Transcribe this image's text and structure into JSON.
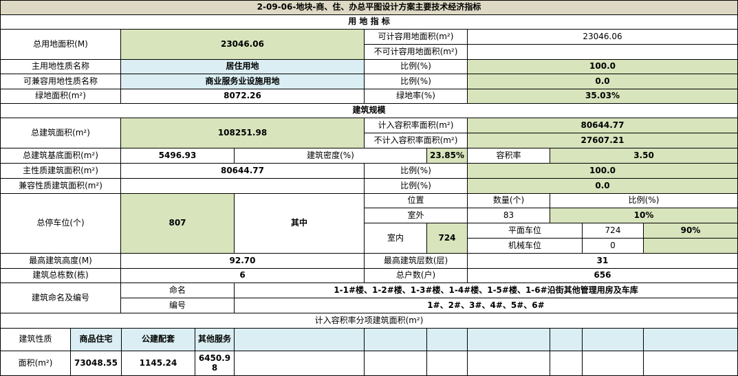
{
  "title": "2-09-06-地块-商、住、办总平图设计方案主要技术经济指标",
  "colors": {
    "green": "#d8e4bc",
    "blue": "#daeef3",
    "header": "#ddd9c4"
  },
  "land": {
    "section": "用 地 指 标",
    "total_label": "总用地面积(M)",
    "total_value": "23046.06",
    "calc_label": "可计容用地面积(m²)",
    "calc_value": "23046.06",
    "noncalc_label": "不可计容用地面积(m²)",
    "noncalc_value": "",
    "main_use_label": "主用地性质名称",
    "main_use_value": "居住用地",
    "ratio_label": "比例(%)",
    "main_ratio": "100.0",
    "compat_use_label": "可兼容用地性质名称",
    "compat_use_value": "商业服务业设施用地",
    "compat_ratio": "0.0",
    "green_area_label": "绿地面积(m²)",
    "green_area_value": "8072.26",
    "green_rate_label": "绿地率(%)",
    "green_rate_value": "35.03%"
  },
  "building": {
    "section": "建筑规模",
    "total_label": "总建筑面积(m²)",
    "total_value": "108251.98",
    "far_area_label": "计入容积率面积(m²)",
    "far_area_value": "80644.77",
    "nonfar_area_label": "不计入容积率面积(m²)",
    "nonfar_area_value": "27607.21",
    "base_label": "总建筑基底面积(m²)",
    "base_value": "5496.93",
    "density_label": "建筑密度(%)",
    "density_value": "23.85%",
    "far_label": "容积率",
    "far_value": "3.50",
    "main_area_label": "主性质建筑面积(m²)",
    "main_area_value": "80644.77",
    "ratio_label": "比例(%)",
    "main_area_ratio": "100.0",
    "compat_area_label": "兼容性质建筑面积(m²)",
    "compat_area_value": "",
    "compat_area_ratio": "0.0"
  },
  "parking": {
    "label": "总停车位(个)",
    "total": "807",
    "of_which": "其中",
    "h_position": "位置",
    "h_count": "数量(个)",
    "h_ratio": "比例(%)",
    "outdoor_label": "室外",
    "outdoor_count": "83",
    "outdoor_ratio": "10%",
    "indoor_label": "室内",
    "indoor_count": "724",
    "surface_label": "平面车位",
    "surface_count": "724",
    "surface_ratio": "90%",
    "mech_label": "机械车位",
    "mech_count": "0",
    "mech_ratio": ""
  },
  "misc": {
    "height_label": "最高建筑高度(M)",
    "height_value": "92.70",
    "floors_label": "最高建筑层数(层)",
    "floors_value": "31",
    "bldg_count_label": "建筑总栋数(栋)",
    "bldg_count_value": "6",
    "households_label": "总户数(户)",
    "households_value": "656",
    "naming_label": "建筑命名及编号",
    "name_label": "命名",
    "name_value": "1-1#楼、1-2#楼、1-3#楼、1-4#楼、1-5#楼、1-6#沿街其他管理用房及车库",
    "number_label": "编号",
    "number_value": "1#、2#、3#、4#、5#、6#"
  },
  "sub": {
    "section": "计入容积率分项建筑面积(m²)",
    "type_label": "建筑性质",
    "area_label": "面积(m²)",
    "headers": [
      "商品住宅",
      "公建配套",
      "其他服务"
    ],
    "values": [
      "73048.55",
      "1145.24",
      "6450.98"
    ]
  }
}
